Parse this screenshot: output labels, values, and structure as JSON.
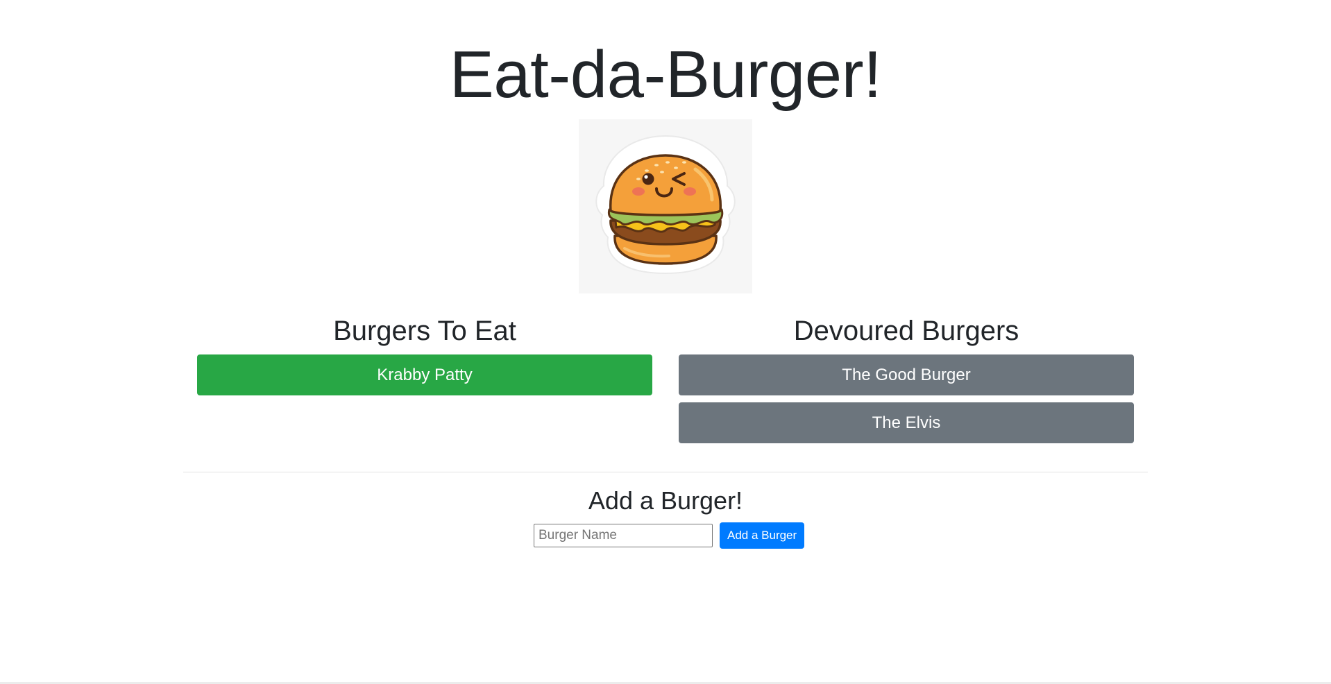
{
  "header": {
    "title": "Eat-da-Burger!"
  },
  "logo": {
    "icon": "winking-burger-icon",
    "background_color": "#f6f6f6"
  },
  "to_eat": {
    "heading": "Burgers To Eat",
    "button_color": "#28a745",
    "items": [
      {
        "name": "Krabby Patty"
      }
    ]
  },
  "devoured": {
    "heading": "Devoured Burgers",
    "button_color": "#6c757d",
    "items": [
      {
        "name": "The Good Burger"
      },
      {
        "name": "The Elvis"
      }
    ]
  },
  "add_form": {
    "heading": "Add a Burger!",
    "input_value": "",
    "input_placeholder": "Burger Name",
    "submit_label": "Add a Burger",
    "submit_color": "#007bff"
  }
}
